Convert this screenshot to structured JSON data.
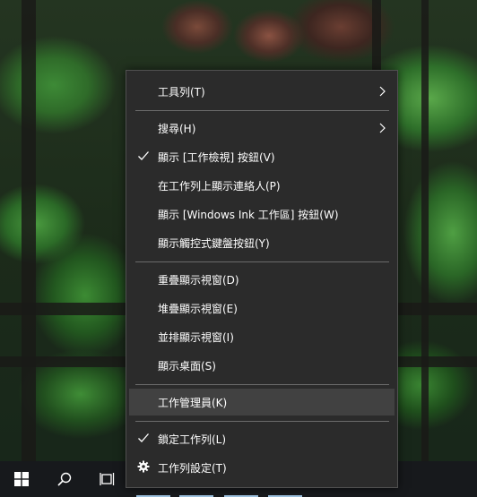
{
  "menu": {
    "items": [
      {
        "label": "工具列(T)",
        "has_submenu": true,
        "checked": false
      },
      {
        "label": "搜尋(H)",
        "has_submenu": true,
        "checked": false
      },
      {
        "label": "顯示 [工作檢視] 按鈕(V)",
        "has_submenu": false,
        "checked": true
      },
      {
        "label": "在工作列上顯示連絡人(P)",
        "has_submenu": false,
        "checked": false
      },
      {
        "label": "顯示 [Windows Ink 工作區] 按鈕(W)",
        "has_submenu": false,
        "checked": false
      },
      {
        "label": "顯示觸控式鍵盤按鈕(Y)",
        "has_submenu": false,
        "checked": false
      },
      {
        "label": "重疊顯示視窗(D)",
        "has_submenu": false,
        "checked": false
      },
      {
        "label": "堆疊顯示視窗(E)",
        "has_submenu": false,
        "checked": false
      },
      {
        "label": "並排顯示視窗(I)",
        "has_submenu": false,
        "checked": false
      },
      {
        "label": "顯示桌面(S)",
        "has_submenu": false,
        "checked": false
      },
      {
        "label": "工作管理員(K)",
        "has_submenu": false,
        "checked": false,
        "highlighted": true
      },
      {
        "label": "鎖定工作列(L)",
        "has_submenu": false,
        "checked": true
      },
      {
        "label": "工作列設定(T)",
        "has_submenu": false,
        "checked": false,
        "icon": "gear-icon"
      }
    ]
  },
  "taskbar": {
    "buttons": [
      "windows-start-icon",
      "search-icon",
      "task-view-icon"
    ]
  },
  "colors": {
    "menu_bg": "#2b2b2b",
    "menu_highlight": "#414141",
    "taskbar_bg": "#17191c",
    "indicator": "#9ec3e0"
  }
}
